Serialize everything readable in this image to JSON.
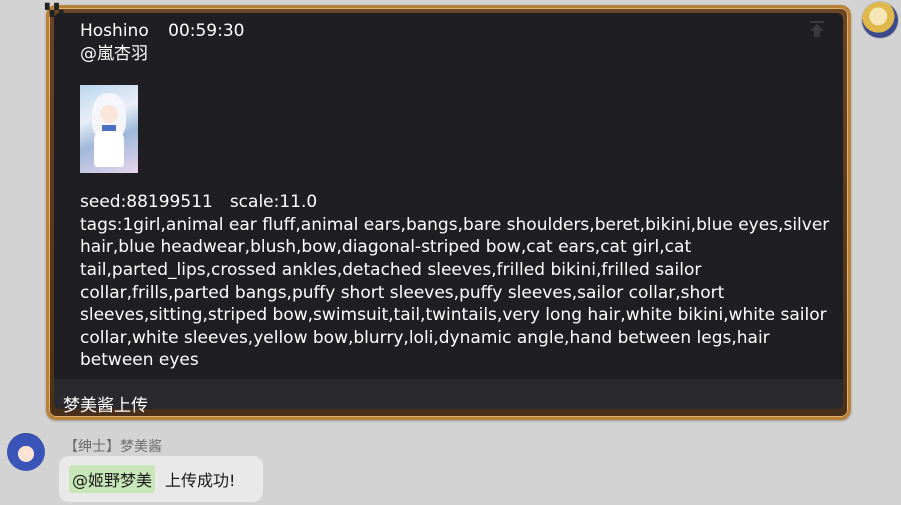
{
  "post": {
    "author": "Hoshino",
    "time": "00:59:30",
    "mention": "@嵐杏羽",
    "seed_line": "seed:88199511　scale:11.0",
    "tags_line": "tags:1girl,animal ear fluff,animal ears,bangs,bare shoulders,beret,bikini,blue eyes,silver hair,blue headwear,blush,bow,diagonal-striped bow,cat ears,cat girl,cat tail,parted_lips,crossed ankles,detached sleeves,frilled bikini,frilled sailor collar,frills,parted bangs,puffy short sleeves,puffy sleeves,sailor collar,short sleeves,sitting,striped bow,swimsuit,tail,twintails,very long hair,white bikini,white sailor collar,white sleeves,yellow bow,blurry,loli,dynamic angle,hand between legs,hair between eyes",
    "footer": "梦美酱上传"
  },
  "reply": {
    "sender": "【绅士】梦美酱",
    "mention": "@姬野梦美",
    "message": "上传成功!"
  },
  "icons": {
    "top": "scroll-to-top-icon"
  },
  "colors": {
    "frame": "#b8823a",
    "bubble_bg": "#1f1e22",
    "page_bg": "#d3d3d3",
    "mention_bg": "#c8e6b8"
  }
}
